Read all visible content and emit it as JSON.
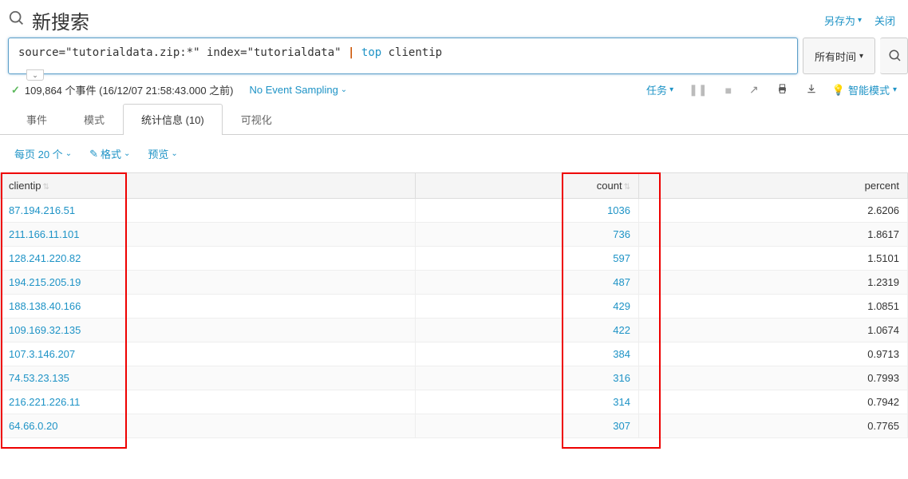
{
  "header": {
    "title": "新搜索",
    "save_as": "另存为",
    "close": "关闭"
  },
  "search": {
    "query_string": "source=\"tutorialdata.zip:*\" index=\"tutorialdata\" ",
    "keyword": "top",
    "arg": "clientip",
    "time_range": "所有时间"
  },
  "status": {
    "eventCountText": "109,864 个事件 (16/12/07 21:58:43.000 之前)",
    "sampling": "No Event Sampling",
    "jobs": "任务",
    "smart_mode": "智能模式"
  },
  "tabs": {
    "events": "事件",
    "patterns": "模式",
    "statistics": "统计信息 (10)",
    "visualization": "可视化"
  },
  "toolbar": {
    "per_page": "每页 20 个",
    "format": "格式",
    "preview": "预览"
  },
  "table": {
    "columns": {
      "clientip": "clientip",
      "count": "count",
      "percent": "percent"
    },
    "rows": [
      {
        "clientip": "87.194.216.51",
        "count": "1036",
        "percent": "2.6206"
      },
      {
        "clientip": "211.166.11.101",
        "count": "736",
        "percent": "1.8617"
      },
      {
        "clientip": "128.241.220.82",
        "count": "597",
        "percent": "1.5101"
      },
      {
        "clientip": "194.215.205.19",
        "count": "487",
        "percent": "1.2319"
      },
      {
        "clientip": "188.138.40.166",
        "count": "429",
        "percent": "1.0851"
      },
      {
        "clientip": "109.169.32.135",
        "count": "422",
        "percent": "1.0674"
      },
      {
        "clientip": "107.3.146.207",
        "count": "384",
        "percent": "0.9713"
      },
      {
        "clientip": "74.53.23.135",
        "count": "316",
        "percent": "0.7993"
      },
      {
        "clientip": "216.221.226.11",
        "count": "314",
        "percent": "0.7942"
      },
      {
        "clientip": "64.66.0.20",
        "count": "307",
        "percent": "0.7765"
      }
    ]
  }
}
